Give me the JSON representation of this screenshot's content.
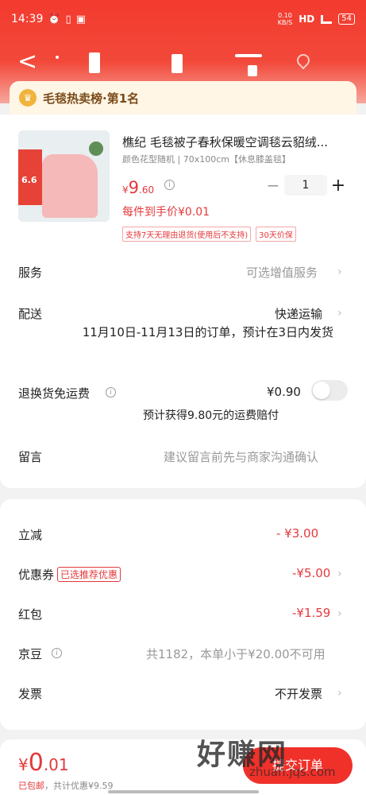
{
  "status_bar": {
    "time": "14:39",
    "net_speed_top": "0.10",
    "net_speed_unit": "KB/S",
    "network": "HD",
    "signal": "5G",
    "battery": "54"
  },
  "nav": {
    "back": "<"
  },
  "hot_banner": {
    "icon": "trophy-icon",
    "text": "毛毯热卖榜·第1名"
  },
  "product": {
    "title": "樵纪 毛毯被子春秋保暖空调毯云貂绒...",
    "spec": "颜色花型随机 | 70x100cm【休息膝盖毯】",
    "price_symbol": "¥",
    "price_int": "9",
    "price_dec": ".60",
    "quantity": "1",
    "minus": "−",
    "plus": "+",
    "hand_price": "每件到手价¥0.01",
    "policies": [
      "支持7天无理由退货(使用后不支持)",
      "30天价保"
    ],
    "thumb_tag": "6.6"
  },
  "rows": {
    "service_label": "服务",
    "service_value": "可选增值服务",
    "delivery_label": "配送",
    "delivery_value": "快递运输",
    "delivery_note": "11月10日-11月13日的订单，预计在3日内发货",
    "return_label": "退换货免运费",
    "return_value": "¥0.90",
    "return_note": "预计获得9.80元的运费赔付",
    "message_label": "留言",
    "message_placeholder": "建议留言前先与商家沟通确认"
  },
  "discounts": {
    "instant_label": "立减",
    "instant_value": "- ¥3.00",
    "coupon_label": "优惠券",
    "coupon_tag": "已选推荐优惠",
    "coupon_value": "-¥5.00",
    "redpacket_label": "红包",
    "redpacket_value": "-¥1.59",
    "jingdou_label": "京豆",
    "jingdou_value": "共1182，本单小于¥20.00不可用",
    "invoice_label": "发票",
    "invoice_value": "不开发票"
  },
  "bottom": {
    "currency": "¥",
    "total_int": "0",
    "total_dec": ".01",
    "shipping": "已包邮",
    "saved": "，共计优惠¥9.59",
    "submit": "提交订单"
  },
  "watermark": {
    "text": "好赚网",
    "url": "zhuan.jqs.com"
  },
  "colors": {
    "accent": "#e4393c",
    "header": "#f33a2e",
    "banner_bg": "#fff6e6"
  }
}
